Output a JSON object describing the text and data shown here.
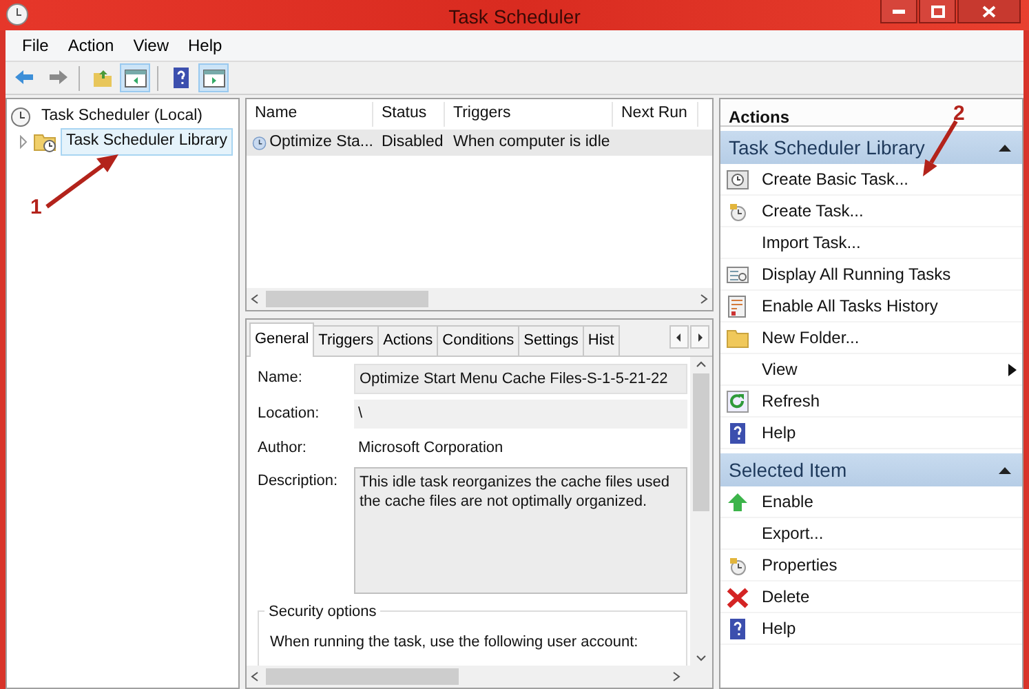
{
  "window": {
    "title": "Task Scheduler"
  },
  "menu": [
    "File",
    "Action",
    "View",
    "Help"
  ],
  "toolbar": [
    {
      "pressed": false
    },
    {
      "pressed": false
    },
    {
      "pressed": false
    },
    {
      "pressed": true
    },
    {
      "pressed": false
    },
    {
      "pressed": true
    }
  ],
  "tree": [
    {
      "label": "Task Scheduler (Local)",
      "selected": false,
      "children": [
        {
          "label": "Task Scheduler Library",
          "selected": true,
          "expanded": false
        }
      ]
    }
  ],
  "task_list": {
    "columns": [
      "Name",
      "Status",
      "Triggers",
      "Next Run"
    ],
    "rows": [
      {
        "cells": [
          "Optimize Sta...",
          "Disabled",
          "When computer is idle",
          ""
        ],
        "selected": true
      }
    ]
  },
  "detail": {
    "tabs": [
      {
        "label": "General",
        "selected": true
      },
      {
        "label": "Triggers",
        "selected": false
      },
      {
        "label": "Actions",
        "selected": false
      },
      {
        "label": "Conditions",
        "selected": false
      },
      {
        "label": "Settings",
        "selected": false
      },
      {
        "label": "Hist",
        "selected": false
      }
    ],
    "fields": [
      {
        "label": "Name:",
        "kind": "field",
        "value": "Optimize Start Menu Cache Files-S-1-5-21-22"
      },
      {
        "label": "Location:",
        "kind": "readonly",
        "value": "\\"
      },
      {
        "label": "Author:",
        "kind": "plain",
        "value": "Microsoft Corporation"
      },
      {
        "label": "Description:",
        "kind": "textarea",
        "lines": [
          "This idle task reorganizes the cache files used",
          "the cache files are not optimally organized."
        ]
      }
    ],
    "security": {
      "title": "Security options",
      "text": "When running the task, use the following user account:"
    }
  },
  "actions": {
    "title": "Actions",
    "sections": [
      {
        "title": "Task Scheduler Library",
        "expanded": true,
        "items": [
          {
            "label": "Create Basic Task..."
          },
          {
            "label": "Create Task..."
          },
          {
            "label": "Import Task..."
          },
          {
            "label": "Display All Running Tasks"
          },
          {
            "label": "Enable All Tasks History"
          },
          {
            "label": "New Folder..."
          },
          {
            "label": "View",
            "submenu": true
          },
          {
            "label": "Refresh"
          },
          {
            "label": "Help"
          }
        ]
      },
      {
        "title": "Selected Item",
        "expanded": true,
        "items": [
          {
            "label": "Enable"
          },
          {
            "label": "Export..."
          },
          {
            "label": "Properties"
          },
          {
            "label": "Delete"
          },
          {
            "label": "Help"
          }
        ]
      }
    ]
  },
  "annotations": [
    {
      "text": "1"
    },
    {
      "text": "2"
    }
  ]
}
